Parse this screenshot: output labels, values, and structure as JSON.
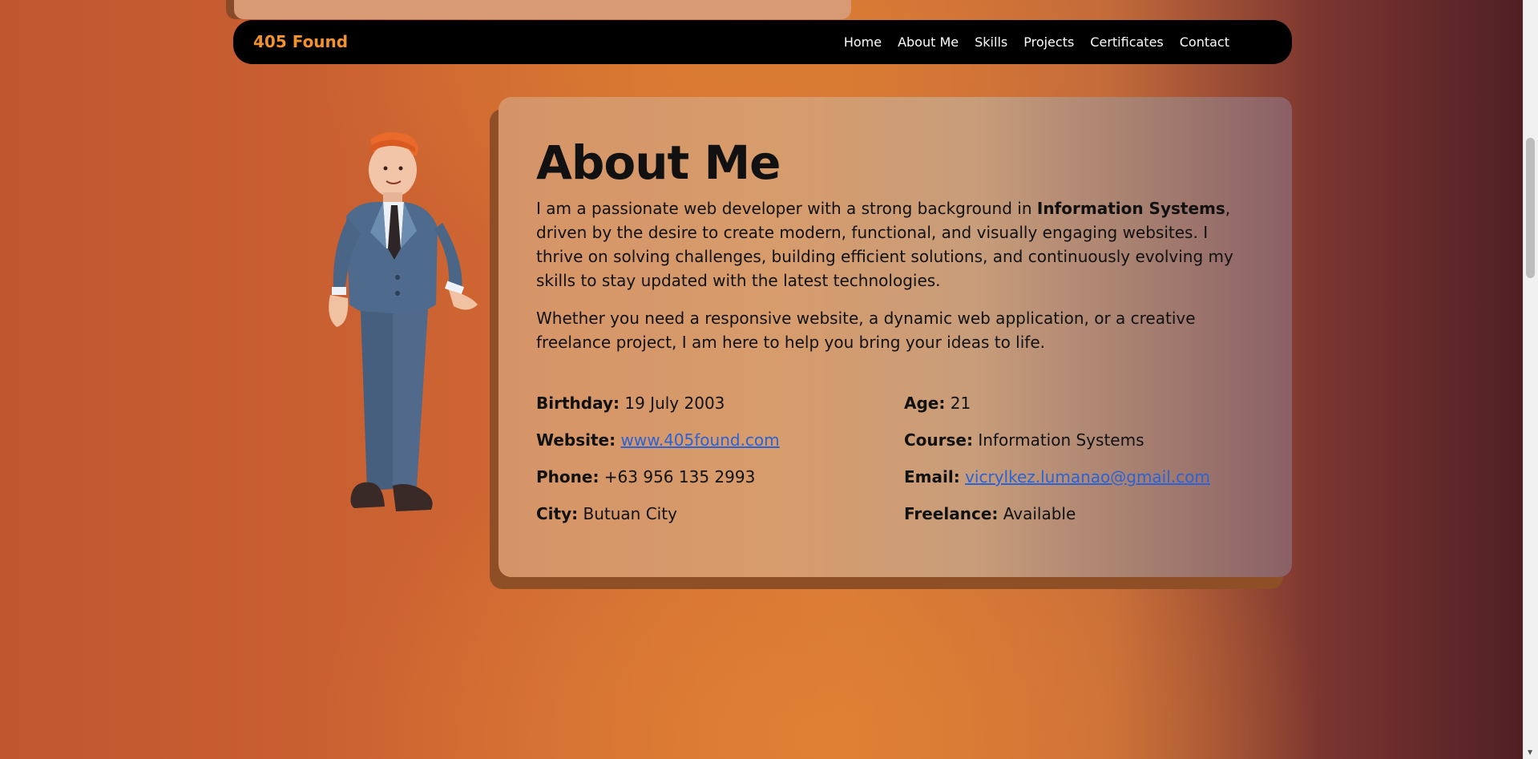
{
  "nav": {
    "brand": "405 Found",
    "links": [
      "Home",
      "About Me",
      "Skills",
      "Projects",
      "Certificates",
      "Contact"
    ]
  },
  "about": {
    "title": "About Me",
    "para1_before": "I am a passionate web developer with a strong background in ",
    "para1_bold": "Information Systems",
    "para1_after": ", driven by the desire to create modern, functional, and visually engaging websites. I thrive on solving challenges, building efficient solutions, and continuously evolving my skills to stay updated with the latest technologies.",
    "para2": "Whether you need a responsive website, a dynamic web application, or a creative freelance project, I am here to help you bring your ideas to life.",
    "info": {
      "birthday_label": "Birthday:",
      "birthday": "19 July 2003",
      "website_label": "Website:",
      "website": "www.405found.com",
      "phone_label": "Phone:",
      "phone": "+63 956 135 2993",
      "city_label": "City:",
      "city": "Butuan City",
      "age_label": "Age:",
      "age": "21",
      "course_label": "Course:",
      "course": "Information Systems",
      "email_label": "Email:",
      "email": "vicrylkez.lumanao@gmail.com",
      "freelance_label": "Freelance:",
      "freelance": "Available"
    }
  },
  "colors": {
    "brand": "#f0922e",
    "link": "#2a63d8",
    "navbar": "#000000"
  },
  "icons": {
    "character": "3d-businessman-illustration"
  }
}
